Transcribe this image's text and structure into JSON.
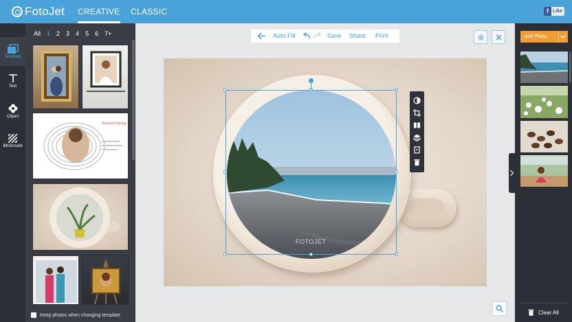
{
  "app": {
    "logo_text": "FotoJet"
  },
  "top_tabs": [
    {
      "label": "CREATIVE",
      "active": true
    },
    {
      "label": "CLASSIC",
      "active": false
    }
  ],
  "facebook": {
    "label": "Like"
  },
  "tools": [
    {
      "label": "Template",
      "icon": "template-icon",
      "active": true
    },
    {
      "label": "Text",
      "icon": "text-icon",
      "active": false
    },
    {
      "label": "Clipart",
      "icon": "clipart-icon",
      "active": false
    },
    {
      "label": "BKGround",
      "icon": "background-icon",
      "active": false
    }
  ],
  "template_filter": [
    "All",
    "1",
    "2",
    "3",
    "4",
    "5",
    "6",
    "7+"
  ],
  "template_filter_selected": "1",
  "templates": [
    {
      "name": "template-thumb-couple-frame"
    },
    {
      "name": "template-thumb-girl-frame"
    },
    {
      "name": "template-thumb-fingerprint",
      "text": "Second Coming"
    },
    {
      "name": "template-thumb-coffee-cup"
    },
    {
      "name": "template-thumb-friends"
    },
    {
      "name": "template-thumb-easel"
    }
  ],
  "keep_photos": {
    "label": "Keep photos when changing template",
    "checked": false
  },
  "editbar": {
    "back_label": "←",
    "autofill": "Auto Fill",
    "save": "Save",
    "share": "Share",
    "print": "Print"
  },
  "watermark": "FOTOJET",
  "right_panel": {
    "add_photo": "Add Photo",
    "photos": [
      "beach-photo",
      "flowers-photo",
      "coffee-beans-photo",
      "girl-photo"
    ],
    "clear_all": "Clear All"
  },
  "colors": {
    "topbar": "#4aa3d8",
    "accent": "#4aa3d8",
    "add_photo": "#f39c34",
    "dark_panel": "#2c2f36"
  }
}
